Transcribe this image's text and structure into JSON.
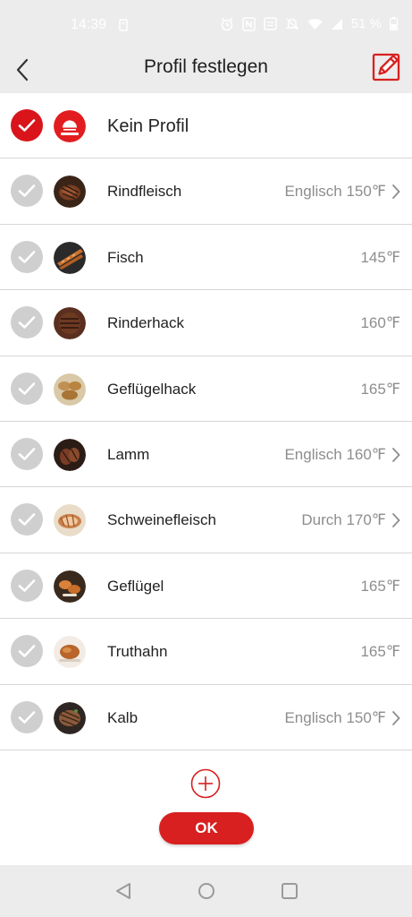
{
  "status_bar": {
    "time": "14:39",
    "battery": "51 %"
  },
  "header": {
    "title": "Profil festlegen"
  },
  "profiles": [
    {
      "name": "Kein Profil",
      "value": "",
      "selected": true,
      "chevron": false,
      "icon": "brand-logo-icon"
    },
    {
      "name": "Rindfleisch",
      "value": "Englisch 150℉",
      "selected": false,
      "chevron": true,
      "icon": "steak-icon"
    },
    {
      "name": "Fisch",
      "value": "145℉",
      "selected": false,
      "chevron": false,
      "icon": "fish-icon"
    },
    {
      "name": "Rinderhack",
      "value": "160℉",
      "selected": false,
      "chevron": false,
      "icon": "burger-patty-icon"
    },
    {
      "name": "Geflügelhack",
      "value": "165℉",
      "selected": false,
      "chevron": false,
      "icon": "poultry-patty-icon"
    },
    {
      "name": "Lamm",
      "value": "Englisch 160℉",
      "selected": false,
      "chevron": true,
      "icon": "lamb-chop-icon"
    },
    {
      "name": "Schweinefleisch",
      "value": "Durch 170℉",
      "selected": false,
      "chevron": true,
      "icon": "pork-roast-icon"
    },
    {
      "name": "Geflügel",
      "value": "165℉",
      "selected": false,
      "chevron": false,
      "icon": "chicken-icon"
    },
    {
      "name": "Truthahn",
      "value": "165℉",
      "selected": false,
      "chevron": false,
      "icon": "turkey-icon"
    },
    {
      "name": "Kalb",
      "value": "Englisch 150℉",
      "selected": false,
      "chevron": true,
      "icon": "veal-icon"
    }
  ],
  "actions": {
    "ok_label": "OK"
  },
  "colors": {
    "accent": "#d7201f",
    "unselected_check": "#cfcfcf",
    "value_text": "#8d8d8d"
  }
}
